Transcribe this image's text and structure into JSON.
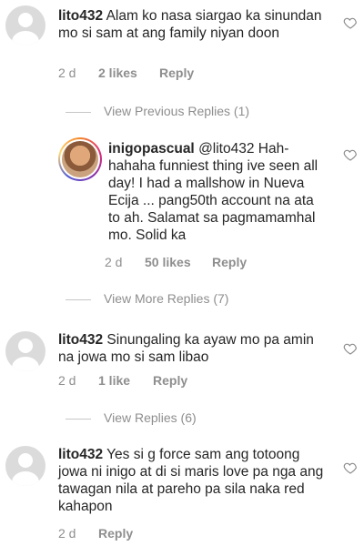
{
  "comments": [
    {
      "user": "lito432",
      "text": "Alam ko nasa siargao ka sinundan mo si sam at ang family niyan doon",
      "time": "2 d",
      "likes": "2 likes",
      "reply": "Reply"
    },
    {
      "user": "inigopascual",
      "text": "@lito432 Hah-hahaha funniest thing ive seen all day! I had a mallshow in Nueva Ecija ... pang50th account na ata to ah. Salamat sa pagmamamhal mo. Solid ka",
      "time": "2 d",
      "likes": "50 likes",
      "reply": "Reply"
    },
    {
      "user": "lito432",
      "text": "Sinungaling ka ayaw mo pa amin na jowa mo si sam libao",
      "time": "2 d",
      "likes": "1 like",
      "reply": "Reply"
    },
    {
      "user": "lito432",
      "text": "Yes si g force sam ang totoong jowa ni inigo at di si maris love pa nga ang tawagan nila at pareho pa sila naka red kahapon",
      "time": "2 d",
      "likes": "",
      "reply": "Reply"
    }
  ],
  "view_previous_replies": "View Previous Replies (1)",
  "view_more_replies": "View More Replies (7)",
  "view_replies": "View Replies (6)",
  "icons": {
    "avatar": "default-avatar-icon",
    "like": "heart-outline-icon"
  }
}
